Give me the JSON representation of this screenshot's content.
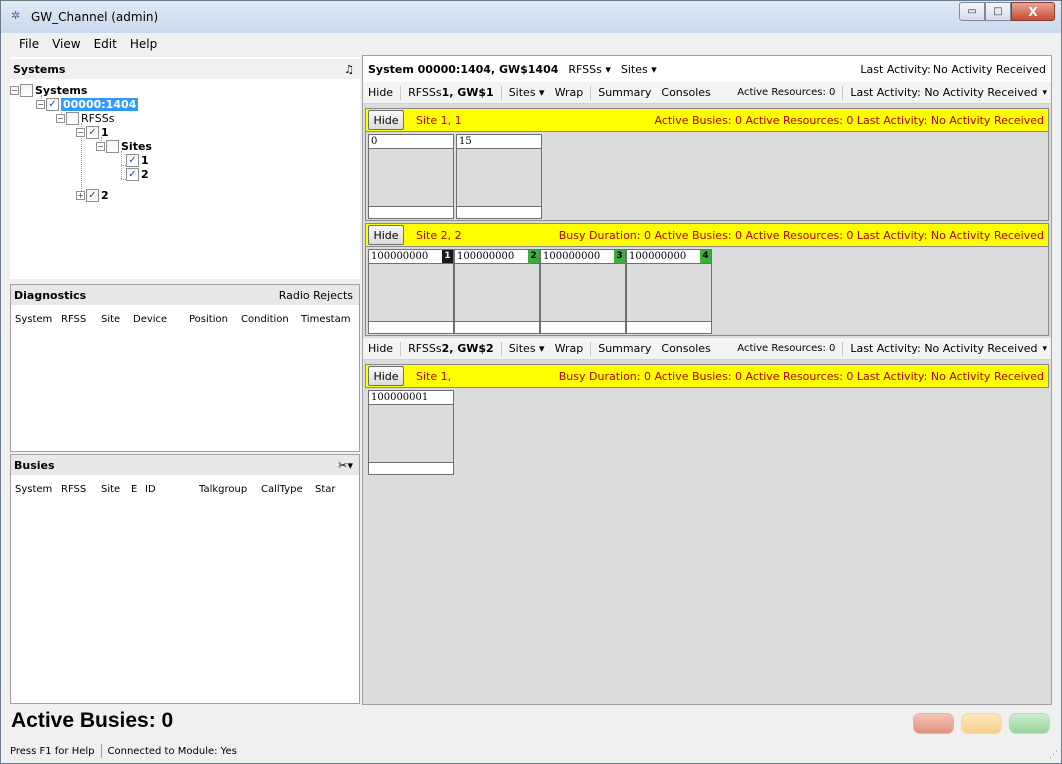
{
  "window": {
    "title": "GW_Channel (admin)",
    "minimize_glyph": "▭",
    "maximize_glyph": "□",
    "close_glyph": "X"
  },
  "menu": [
    "File",
    "View",
    "Edit",
    "Help"
  ],
  "systems_panel": {
    "title": "Systems",
    "bell_glyph": "♫",
    "tree": {
      "root": "Systems",
      "system": "00000:1404",
      "rfsss": "RFSSs",
      "rfss1": "1",
      "sites": "Sites",
      "site1": "1",
      "site2": "2",
      "rfss2": "2"
    }
  },
  "diagnostics_panel": {
    "title": "Diagnostics",
    "right_label": "Radio Rejects",
    "columns": [
      "System",
      "RFSS",
      "Site",
      "Device",
      "Position",
      "Condition",
      "Timestam"
    ]
  },
  "busies_panel": {
    "title": "Busies",
    "tool_glyph": "✂▾",
    "columns": [
      "System",
      "RFSS",
      "Site",
      "E",
      "ID",
      "Talkgroup",
      "CallType",
      "Star"
    ]
  },
  "system_bar": {
    "title": "System 00000:1404, GW$1404",
    "rfsss_dropdown": "RFSSs ▾",
    "sites_dropdown": "Sites ▾",
    "last_activity_label": "Last Activity:",
    "last_activity_value": "No Activity Received"
  },
  "rfss_bars": [
    {
      "hide": "Hide",
      "prefix": "RFSSs ",
      "name": "1, GW$1",
      "sites": "Sites ▾",
      "wrap": "Wrap",
      "summary": "Summary",
      "consoles": "Consoles",
      "active_resources": "Active Resources: 0",
      "last_activity": "Last Activity:  No Activity Received",
      "more": "▾"
    },
    {
      "hide": "Hide",
      "prefix": "RFSSs ",
      "name": "2, GW$2",
      "sites": "Sites ▾",
      "wrap": "Wrap",
      "summary": "Summary",
      "consoles": "Consoles",
      "active_resources": "Active Resources: 0",
      "last_activity": "Last Activity:  No Activity Received",
      "more": "▾"
    }
  ],
  "sites": [
    {
      "hide": "Hide",
      "name": "Site 1, 1",
      "stats": "Active Busies: 0    Active Resources: 0  Last Activity: No Activity Received",
      "channels": [
        {
          "id": "0",
          "badge": ""
        },
        {
          "id": "15",
          "badge": ""
        }
      ]
    },
    {
      "hide": "Hide",
      "name": "Site 2, 2",
      "stats": "Busy Duration: 0    Active Busies: 0    Active Resources: 0  Last Activity: No Activity Received",
      "channels": [
        {
          "id": "100000000",
          "badge": "1",
          "badge_color": "black"
        },
        {
          "id": "100000000",
          "badge": "2",
          "badge_color": "green"
        },
        {
          "id": "100000000",
          "badge": "3",
          "badge_color": "green"
        },
        {
          "id": "100000000",
          "badge": "4",
          "badge_color": "green"
        }
      ]
    },
    {
      "hide": "Hide",
      "name": "Site 1,",
      "stats": "Busy Duration: 0    Active Busies: 0    Active Resources: 0  Last Activity: No Activity Received",
      "channels": [
        {
          "id": "100000001",
          "badge": ""
        }
      ]
    }
  ],
  "footer": {
    "active_busies": "Active Busies:  0",
    "help": "Press F1 for Help",
    "connected": "Connected to Module: Yes",
    "led_colors": [
      "#e8a090",
      "#f7d79a",
      "#a9dcaa"
    ]
  }
}
